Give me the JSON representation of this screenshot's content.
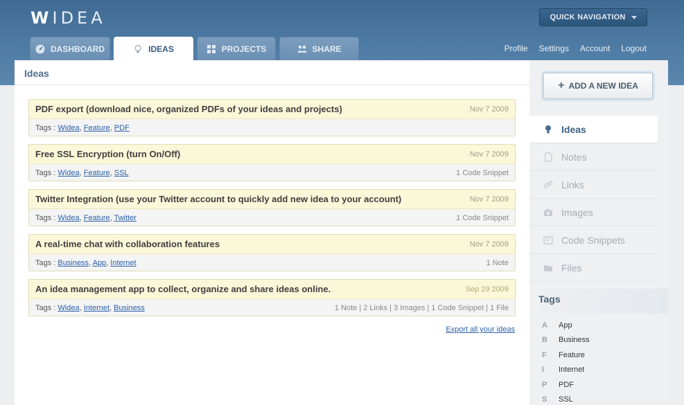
{
  "app": {
    "logo_prefix": "W",
    "logo_rest": "IDEA"
  },
  "quick_nav": {
    "label": "QUICK NAVIGATION"
  },
  "tabs": [
    {
      "label": "DASHBOARD",
      "icon": "gauge-icon",
      "active": false
    },
    {
      "label": "IDEAS",
      "icon": "lightbulb-icon",
      "active": true
    },
    {
      "label": "PROJECTS",
      "icon": "grid-icon",
      "active": false
    },
    {
      "label": "SHARE",
      "icon": "people-icon",
      "active": false
    }
  ],
  "top_links": [
    "Profile",
    "Settings",
    "Account",
    "Logout"
  ],
  "main": {
    "title": "Ideas",
    "ideas": [
      {
        "title": "PDF export (download nice, organized PDFs of your ideas and projects)",
        "date": "Nov 7 2009",
        "tags_label": "Tags :",
        "tags": [
          "Widea",
          "Feature",
          "PDF"
        ],
        "meta": ""
      },
      {
        "title": "Free SSL Encryption (turn On/Off)",
        "date": "Nov 7 2009",
        "tags_label": "Tags :",
        "tags": [
          "Widea",
          "Feature",
          "SSL"
        ],
        "meta": "1 Code Snippet"
      },
      {
        "title": "Twitter Integration (use your Twitter account to quickly add new idea to your account)",
        "date": "Nov 7 2009",
        "tags_label": "Tags :",
        "tags": [
          "Widea",
          "Feature",
          "Twitter"
        ],
        "meta": "1 Code Snippet"
      },
      {
        "title": "A real-time chat with collaboration features",
        "date": "Nov 7 2009",
        "tags_label": "Tags :",
        "tags": [
          "Business",
          "App",
          "Internet"
        ],
        "meta": "1 Note"
      },
      {
        "title": "An idea management app to collect, organize and share ideas online.",
        "date": "Sep 29 2009",
        "tags_label": "Tags :",
        "tags": [
          "Widea",
          "Internet",
          "Business"
        ],
        "meta": "1 Note | 2 Links | 3 Images | 1 Code Snippet | 1 File"
      }
    ],
    "export_link": "Export all your ideas"
  },
  "sidebar": {
    "add_button": "ADD A NEW IDEA",
    "menu": [
      {
        "label": "Ideas",
        "icon": "lightbulb-icon",
        "active": true
      },
      {
        "label": "Notes",
        "icon": "document-icon",
        "active": false
      },
      {
        "label": "Links",
        "icon": "link-icon",
        "active": false
      },
      {
        "label": "Images",
        "icon": "camera-icon",
        "active": false
      },
      {
        "label": "Code Snippets",
        "icon": "code-icon",
        "active": false
      },
      {
        "label": "Files",
        "icon": "folder-icon",
        "active": false
      }
    ],
    "tags_title": "Tags",
    "tags": [
      {
        "letter": "A",
        "name": "App"
      },
      {
        "letter": "B",
        "name": "Business"
      },
      {
        "letter": "F",
        "name": "Feature"
      },
      {
        "letter": "I",
        "name": "Internet"
      },
      {
        "letter": "P",
        "name": "PDF"
      },
      {
        "letter": "S",
        "name": "SSL"
      }
    ]
  },
  "colors": {
    "header_blue": "#4d7aa3",
    "link_blue": "#2a5fa8",
    "idea_header_bg": "#fbf7d9"
  }
}
